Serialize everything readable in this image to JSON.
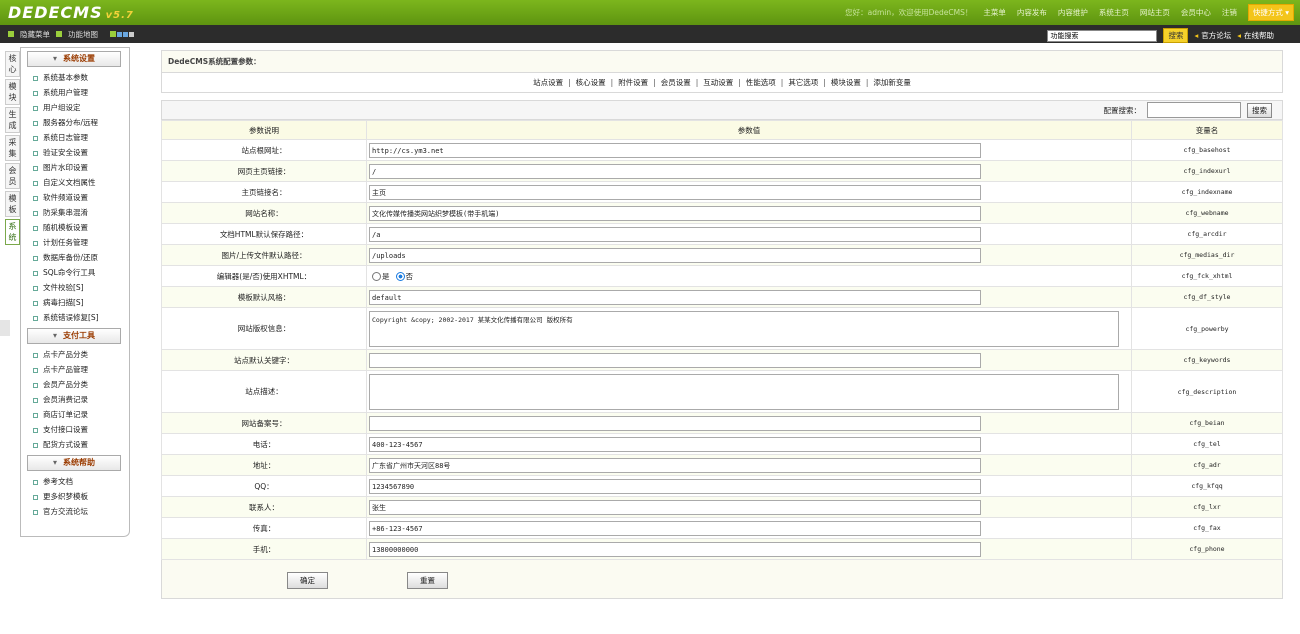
{
  "app": {
    "logo": "DEDECMS",
    "version": "v5.7"
  },
  "topnav": {
    "welcome": "您好：admin，欢迎使用DedeCMS！",
    "links": [
      "主菜单",
      "内容发布",
      "内容维护",
      "系统主页",
      "网站主页",
      "会员中心",
      "注销"
    ],
    "quick": "快捷方式 ▾"
  },
  "toolbar": {
    "hide_menu": "隐藏菜单",
    "func_map": "功能地图",
    "search_placeholder": "功能搜索",
    "search_btn": "搜索",
    "forum": "官方论坛",
    "help": "在线帮助"
  },
  "vtabs": [
    "核心",
    "模块",
    "生成",
    "采集",
    "会员",
    "模板",
    "系统"
  ],
  "menu": {
    "groups": [
      {
        "title": "系统设置",
        "items": [
          "系统基本参数",
          "系统用户管理",
          "用户组设定",
          "服务器分布/远程",
          "系统日志管理",
          "验证安全设置",
          "图片水印设置",
          "自定义文档属性",
          "软件频道设置",
          "防采集串混淆",
          "随机模板设置",
          "计划任务管理",
          "数据库备份/还原",
          "SQL命令行工具",
          "文件校验[S]",
          "病毒扫描[S]",
          "系统错误修复[S]"
        ]
      },
      {
        "title": "支付工具",
        "items": [
          "点卡产品分类",
          "点卡产品管理",
          "会员产品分类",
          "会员消费记录",
          "商店订单记录",
          "支付接口设置",
          "配货方式设置"
        ]
      },
      {
        "title": "系统帮助",
        "items": [
          "参考文档",
          "更多织梦模板",
          "官方交流论坛"
        ]
      }
    ]
  },
  "main": {
    "title": "DedeCMS系统配置参数：",
    "tabs": [
      "站点设置",
      "核心设置",
      "附件设置",
      "会员设置",
      "互动设置",
      "性能选项",
      "其它选项",
      "模块设置",
      "添加新变量"
    ],
    "search_label": "配置搜索：",
    "search_btn": "搜索",
    "headers": [
      "参数说明",
      "参数值",
      "变量名"
    ],
    "rows": [
      {
        "label": "站点根网址：",
        "value": "http://cs.ym3.net",
        "var": "cfg_basehost",
        "type": "text"
      },
      {
        "label": "网页主页链接：",
        "value": "/",
        "var": "cfg_indexurl",
        "type": "text"
      },
      {
        "label": "主页链接名：",
        "value": "主页",
        "var": "cfg_indexname",
        "type": "text"
      },
      {
        "label": "网站名称：",
        "value": "文化传媒传播类网站织梦模板(带手机端)",
        "var": "cfg_webname",
        "type": "text"
      },
      {
        "label": "文档HTML默认保存路径：",
        "value": "/a",
        "var": "cfg_arcdir",
        "type": "text"
      },
      {
        "label": "图片/上传文件默认路径：",
        "value": "/uploads",
        "var": "cfg_medias_dir",
        "type": "text"
      },
      {
        "label": "编辑器(是/否)使用XHTML：",
        "value": "",
        "var": "cfg_fck_xhtml",
        "type": "radio",
        "opt_yes": "是",
        "opt_no": "否"
      },
      {
        "label": "模板默认风格：",
        "value": "default",
        "var": "cfg_df_style",
        "type": "text"
      },
      {
        "label": "网站版权信息：",
        "value": "Copyright &copy; 2002-2017 某某文化传播有限公司 版权所有",
        "var": "cfg_powerby",
        "type": "textarea"
      },
      {
        "label": "站点默认关键字：",
        "value": "",
        "var": "cfg_keywords",
        "type": "text"
      },
      {
        "label": "站点描述：",
        "value": "",
        "var": "cfg_description",
        "type": "textarea"
      },
      {
        "label": "网站备案号：",
        "value": "",
        "var": "cfg_beian",
        "type": "text"
      },
      {
        "label": "电话：",
        "value": "400-123-4567",
        "var": "cfg_tel",
        "type": "text"
      },
      {
        "label": "地址：",
        "value": "广东省广州市天河区88号",
        "var": "cfg_adr",
        "type": "text"
      },
      {
        "label": "QQ：",
        "value": "1234567890",
        "var": "cfg_kfqq",
        "type": "text"
      },
      {
        "label": "联系人：",
        "value": "张生",
        "var": "cfg_lxr",
        "type": "text"
      },
      {
        "label": "传真：",
        "value": "+86-123-4567",
        "var": "cfg_fax",
        "type": "text"
      },
      {
        "label": "手机：",
        "value": "13800000000",
        "var": "cfg_phone",
        "type": "text"
      }
    ],
    "ok_btn": "确定",
    "reset_btn": "重置"
  }
}
